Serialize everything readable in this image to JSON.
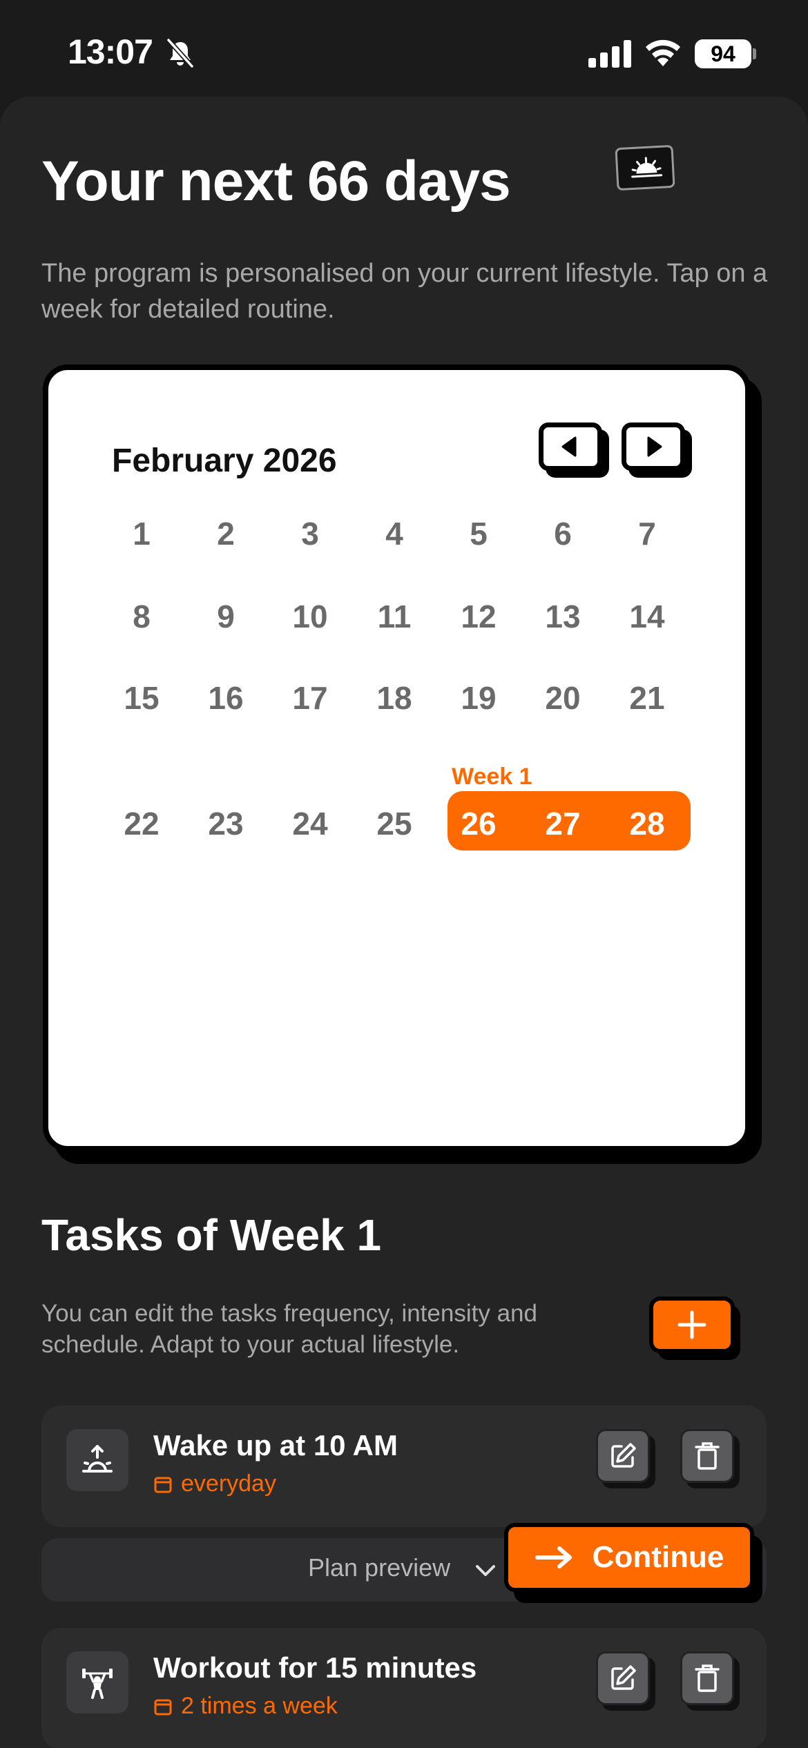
{
  "status_bar": {
    "time": "13:07",
    "battery": "94"
  },
  "header": {
    "title": "Your next 66 days",
    "subtitle": "The program is personalised on your current lifestyle. Tap on a week for detailed routine."
  },
  "calendar": {
    "month_label": "February 2026",
    "week_label": "Week 1",
    "rows": [
      [
        "1",
        "2",
        "3",
        "4",
        "5",
        "6",
        "7"
      ],
      [
        "8",
        "9",
        "10",
        "11",
        "12",
        "13",
        "14"
      ],
      [
        "15",
        "16",
        "17",
        "18",
        "19",
        "20",
        "21"
      ],
      [
        "22",
        "23",
        "24",
        "25",
        "26",
        "27",
        "28"
      ]
    ],
    "selected_days": [
      "26",
      "27",
      "28"
    ],
    "accent": "#ff6a00"
  },
  "tasks": {
    "title": "Tasks of Week 1",
    "description": "You can edit the tasks frequency, intensity and schedule. Adapt to your actual lifestyle.",
    "items": [
      {
        "name": "Wake up at 10 AM",
        "frequency": "everyday",
        "icon": "sunrise-icon"
      },
      {
        "name": "Workout for 15 minutes",
        "frequency": "2 times a week",
        "icon": "weightlifter-icon"
      }
    ]
  },
  "footer": {
    "preview_label": "Plan preview",
    "continue_label": "Continue"
  }
}
